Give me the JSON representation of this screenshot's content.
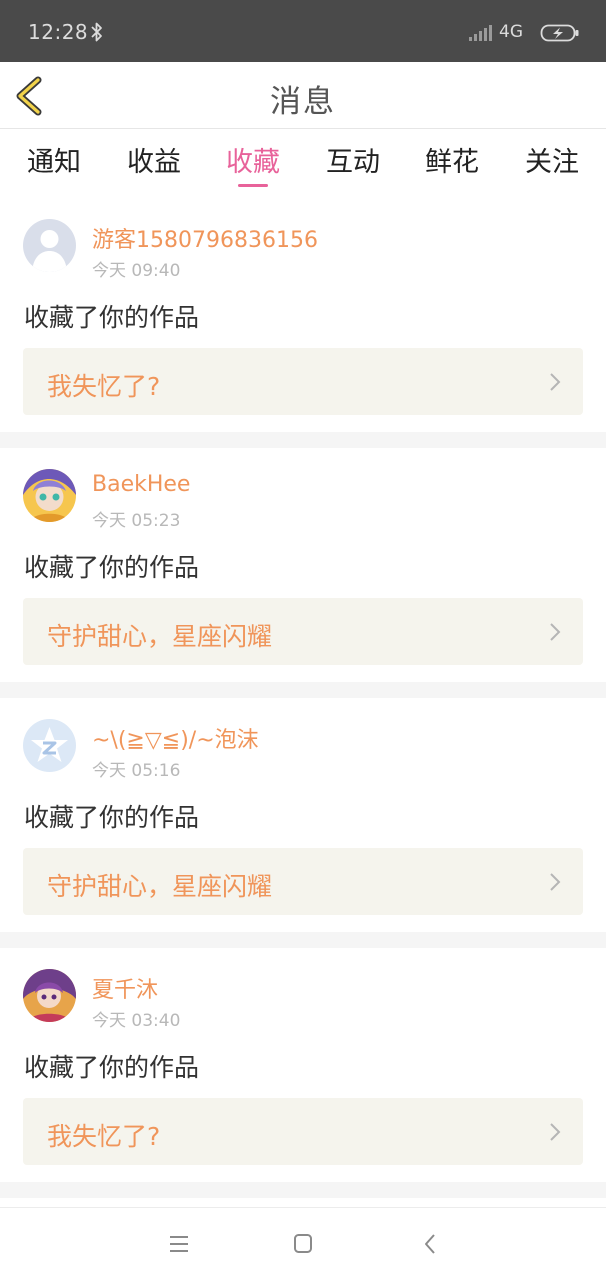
{
  "status_bar": {
    "time": "12:28",
    "network": "4G",
    "icons": [
      "bluetooth-icon",
      "signal-icon",
      "battery-charging-icon"
    ]
  },
  "header": {
    "title": "消息",
    "back_icon": "chevron-left-icon"
  },
  "tabs": [
    {
      "label": "通知",
      "active": false
    },
    {
      "label": "收益",
      "active": false
    },
    {
      "label": "收藏",
      "active": true
    },
    {
      "label": "互动",
      "active": false
    },
    {
      "label": "鲜花",
      "active": false
    },
    {
      "label": "关注",
      "active": false
    }
  ],
  "colors": {
    "accent": "#e8629a",
    "username": "#f0955a",
    "link_bg": "#f5f4ed",
    "status_bar_bg": "#4a4a4a"
  },
  "messages": [
    {
      "username": "游客1580796836156",
      "time": "今天 09:40",
      "action": "收藏了你的作品",
      "work": "我失忆了?",
      "avatar": "default-avatar-icon"
    },
    {
      "username": "BaekHee",
      "time": "今天 05:23",
      "action": "收藏了你的作品",
      "work": "守护甜心，星座闪耀",
      "avatar": "anime-avatar"
    },
    {
      "username": "~\\(≧▽≦)/~泡沫",
      "time": "今天 05:16",
      "action": "收藏了你的作品",
      "work": "守护甜心，星座闪耀",
      "avatar": "qzone-star-avatar-icon"
    },
    {
      "username": "夏千沐",
      "time": "今天 03:40",
      "action": "收藏了你的作品",
      "work": "我失忆了?",
      "avatar": "anime-avatar"
    }
  ],
  "nav_bar": {
    "icons": [
      "menu-icon",
      "home-square-icon",
      "back-triangle-icon"
    ]
  }
}
